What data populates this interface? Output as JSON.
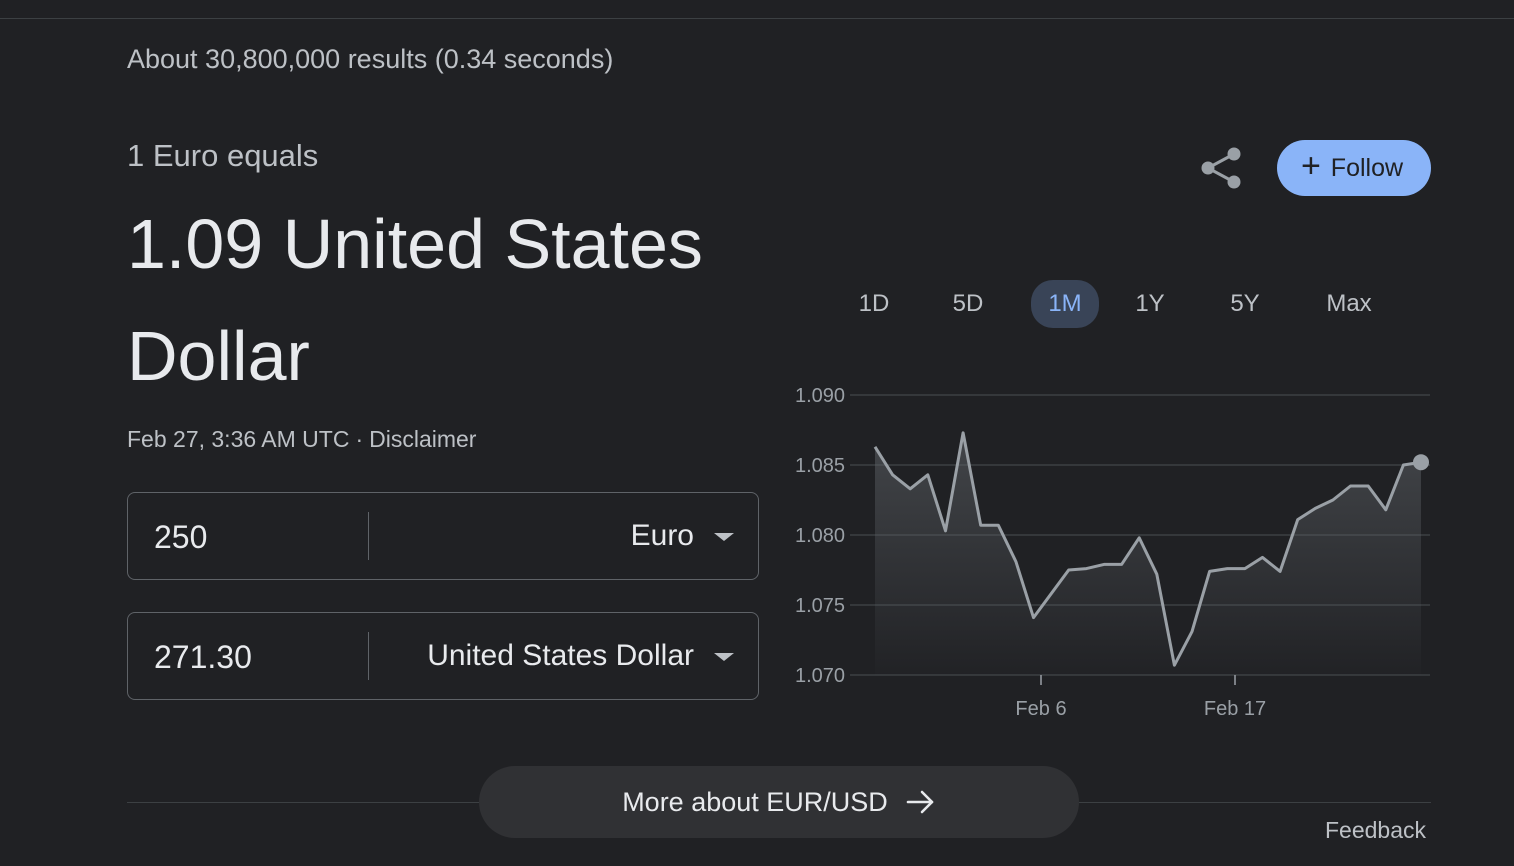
{
  "result_stats": "About 30,800,000 results (0.34 seconds)",
  "header": {
    "equals_label": "1 Euro equals",
    "converted_value": "1.09 United States Dollar"
  },
  "meta": {
    "timestamp": "Feb 27, 3:36 AM UTC",
    "separator": "·",
    "disclaimer": "Disclaimer"
  },
  "converter": {
    "from": {
      "amount": "250",
      "currency": "Euro"
    },
    "to": {
      "amount": "271.30",
      "currency": "United States Dollar"
    }
  },
  "actions": {
    "share_icon": "share-icon",
    "follow_label": "Follow",
    "follow_icon": "+"
  },
  "ranges": [
    {
      "label": "1D",
      "active": false
    },
    {
      "label": "5D",
      "active": false
    },
    {
      "label": "1M",
      "active": true
    },
    {
      "label": "1Y",
      "active": false
    },
    {
      "label": "5Y",
      "active": false
    },
    {
      "label": "Max",
      "active": false
    }
  ],
  "chart_data": {
    "type": "area",
    "y_ticks": [
      "1.090",
      "1.085",
      "1.080",
      "1.075",
      "1.070"
    ],
    "ylim": [
      1.07,
      1.09
    ],
    "x_tick_labels": [
      "Feb 6",
      "Feb 17"
    ],
    "grid": true,
    "values": [
      1.0863,
      1.0843,
      1.0833,
      1.0843,
      1.0803,
      1.0873,
      1.0807,
      1.0807,
      1.0781,
      1.0741,
      1.0758,
      1.0775,
      1.0776,
      1.0779,
      1.0779,
      1.0798,
      1.0772,
      1.0707,
      1.0731,
      1.0774,
      1.0776,
      1.0776,
      1.0784,
      1.0774,
      1.0811,
      1.0819,
      1.0825,
      1.0835,
      1.0835,
      1.0818,
      1.085,
      1.0852
    ],
    "colors": {
      "line": "#9aa0a6",
      "grid": "#3c4043"
    }
  },
  "more_button": {
    "label": "More about EUR/USD",
    "icon": "arrow-right-icon"
  },
  "feedback": "Feedback"
}
